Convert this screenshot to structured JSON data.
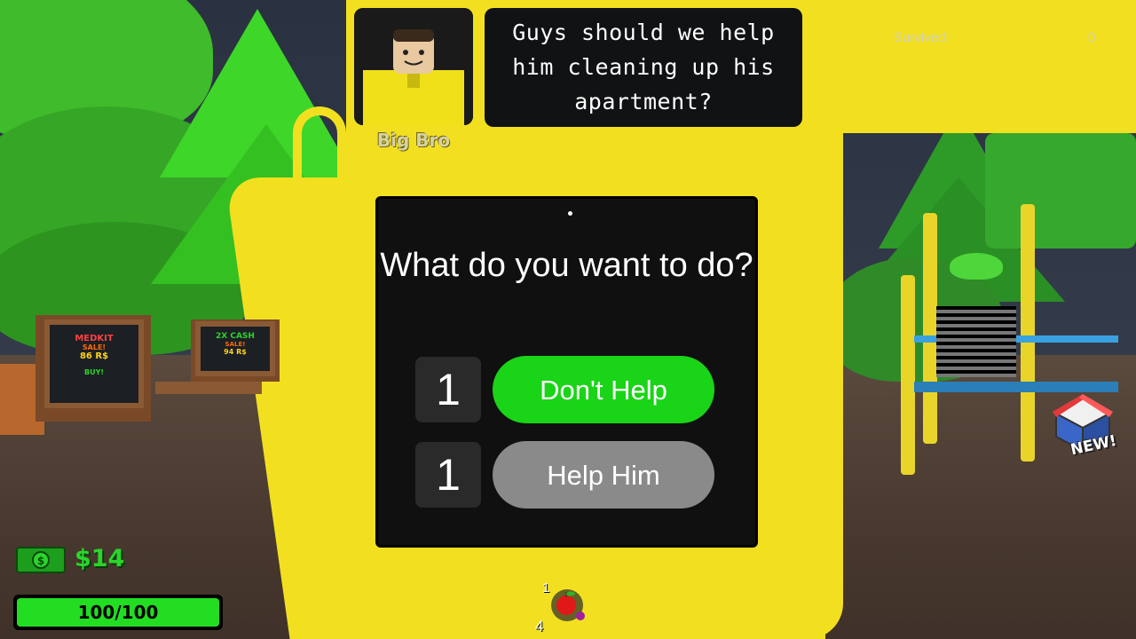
{
  "dialogue": {
    "speaker_name": "Big Bro",
    "message": "Guys should we help him cleaning up his apartment?"
  },
  "survived": {
    "label": "Survived:",
    "value": "0"
  },
  "choice_modal": {
    "question": "What do you want to do?",
    "options": [
      {
        "label": "Don't Help",
        "votes": "1",
        "color": "#1ad417"
      },
      {
        "label": "Help Him",
        "votes": "1",
        "color": "#8a8a8a"
      }
    ]
  },
  "hud": {
    "cash": "$14",
    "health_text": "100/100",
    "health_fraction": 1.0,
    "hotbar": {
      "key": "1",
      "count": "4",
      "item_icon": "apple-icon"
    }
  },
  "world_signs": {
    "medkit": {
      "title": "MEDKIT",
      "sale": "SALE!",
      "price": "86 R$",
      "cta": "BUY!"
    },
    "cash": {
      "title": "2X CASH",
      "sale": "SALE!",
      "price": "94 R$"
    }
  },
  "shop": {
    "badge": "NEW!",
    "icon": "shop-icon"
  },
  "colors": {
    "accent_green": "#1ad417",
    "cash_green": "#2bd52b",
    "character_yellow": "#f2e020"
  }
}
